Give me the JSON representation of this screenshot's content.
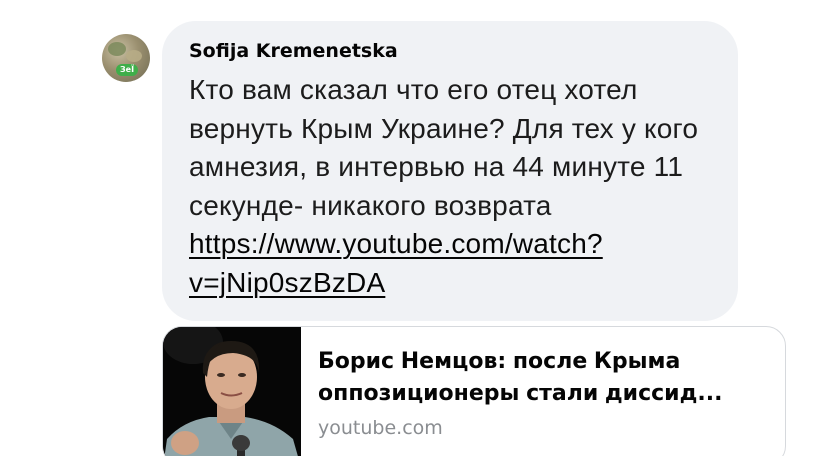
{
  "comment": {
    "author_name": "Sofija Kremenetska",
    "avatar_badge": "ЗеЇ",
    "text": "Кто вам сказал что его отец хотел вернуть Крым Украине? Для тех у кого амнезия, в интервью на 44 минуте 11 секунде- никакого возврата ",
    "link_text": "https://www.youtube.com/watch?v=jNip0szBzDA"
  },
  "link_preview": {
    "title_line1": "Борис Немцов: после Крыма",
    "title_line2": "оппозиционеры стали диссид...",
    "domain": "youtube.com"
  },
  "colors": {
    "bubble_background": "#f0f2f5",
    "text": "#050505",
    "secondary_text": "#8a8d91",
    "card_border": "#d6d9dd"
  },
  "icons": {
    "avatar": "user-photo-avatar",
    "thumbnail": "video-thumbnail-man-with-microphone"
  }
}
